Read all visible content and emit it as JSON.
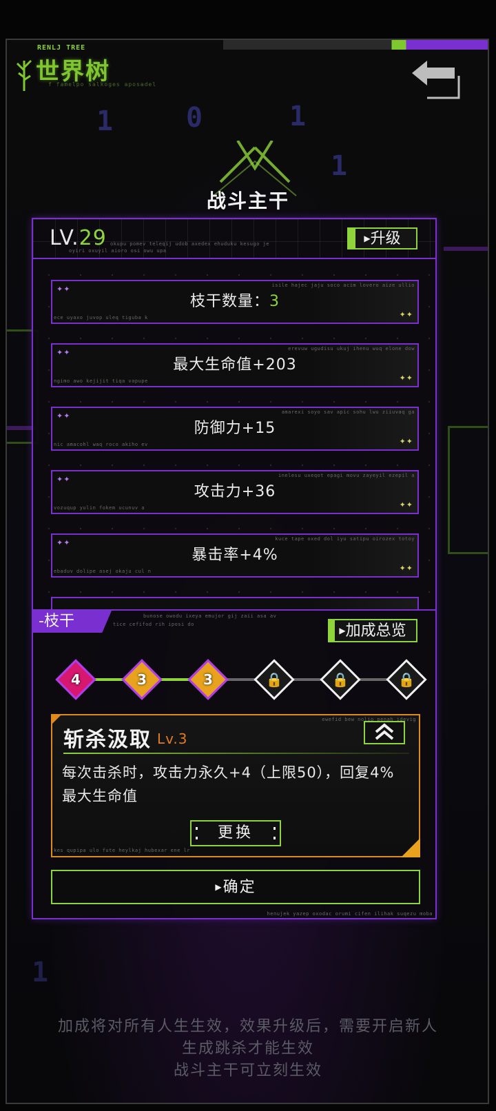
{
  "header": {
    "logo_small": "RENLJ TREE",
    "logo_title": "世界树",
    "logo_sub": "f famelpo salkoges aposadel"
  },
  "title": "战斗主干",
  "level": {
    "prefix": "LV.",
    "value": "29",
    "upgrade_label": "升级",
    "deco1": "okupu pomev teleqij udob axedex ehuduku kesugo je",
    "deco2": "oyiri oxuyil aioro osi owu upa"
  },
  "stats": [
    {
      "label": "枝干数量：",
      "value": "3",
      "deco_top": "isile hajec jaju soco acim lovero aize ullio",
      "deco_bottom": "ece uyaxo juvop uleq tiguba k"
    },
    {
      "label": "最大生命值+203",
      "value": "",
      "deco_top": "erevuw ugudisu ukuj ihenu wuq elone dow",
      "deco_bottom": "ngimo awo kejijit tiqa vapupe"
    },
    {
      "label": "防御力+15",
      "value": "",
      "deco_top": "amarexi soyo sav apic sohu lwu ziiuvaq ga",
      "deco_bottom": "nic amacohl waq roco akiho ev"
    },
    {
      "label": "攻击力+36",
      "value": "",
      "deco_top": "inelesu uxeqot epagi movu zayeyil ezepil a",
      "deco_bottom": "vozuqup yulin fokem ucunuv a"
    },
    {
      "label": "暴击率+4%",
      "value": "",
      "deco_top": "kuce tape oxed dol iyu satipu oirozex totoy",
      "deco_bottom": "ebaduv dolipe asej okaju cul n"
    }
  ],
  "branch": {
    "tab_label": "-枝干",
    "overview_label": "加成总览",
    "deco1": "bunose owodu ixeya emujor gij zaii asa av",
    "deco2": "tice cefifod rih iposi do",
    "nodes": [
      {
        "label": "4",
        "locked": false,
        "color": "#d6186e"
      },
      {
        "label": "3",
        "locked": false,
        "color": "#e8a21d"
      },
      {
        "label": "3",
        "locked": false,
        "color": "#e8a21d"
      },
      {
        "label": "",
        "locked": true,
        "color": "#1a1a1a"
      },
      {
        "label": "",
        "locked": true,
        "color": "#1a1a1a"
      },
      {
        "label": "",
        "locked": true,
        "color": "#1a1a1a"
      }
    ]
  },
  "skill": {
    "name": "斩杀汲取",
    "level": "Lv.3",
    "description": "每次击杀时，攻击力永久+4（上限50），回复4%最大生命值",
    "swap_label": "更换",
    "deco_top": "ewefid bew nolio penah idevig",
    "deco_bottom": "kes qupipa ulo fute heylkaj hubexar ene lr"
  },
  "confirm_label": "确定",
  "panel_deco": "henujek yazep oxodac orumi cifen ilihak suqezu moba",
  "footer_lines": [
    "加成将对所有人生生效，效果升级后，需要开启新人",
    "生成跳杀才能生效",
    "战斗主干可立刻生效"
  ],
  "colors": {
    "accent_green": "#8fd43a",
    "accent_purple": "#7a2fd0",
    "accent_orange": "#e08a1a"
  }
}
